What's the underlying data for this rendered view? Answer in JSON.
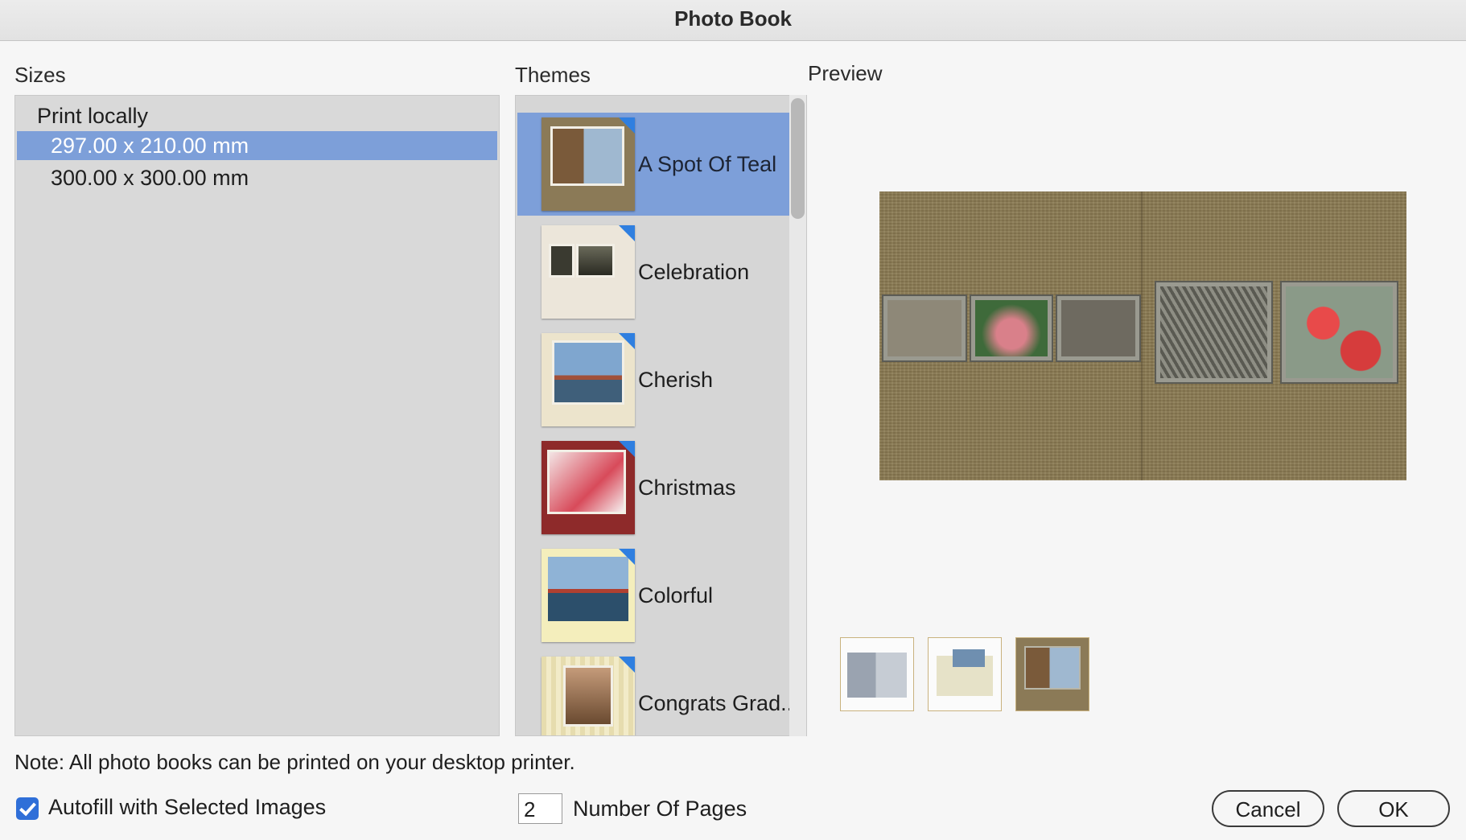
{
  "window": {
    "title": "Photo Book"
  },
  "sizes": {
    "label": "Sizes",
    "group": "Print locally",
    "items": [
      "297.00 x 210.00 mm",
      "300.00 x 300.00 mm"
    ],
    "selected_index": 0
  },
  "themes": {
    "label": "Themes",
    "items": [
      "A Spot Of Teal",
      "Celebration",
      "Cherish",
      "Christmas",
      "Colorful",
      "Congrats Grad..."
    ],
    "selected_index": 0
  },
  "preview": {
    "label": "Preview",
    "page_thumbnails": [
      "layout-thumbnail-1",
      "layout-thumbnail-2",
      "cover-thumbnail"
    ]
  },
  "note": "Note: All photo books can be printed on your desktop printer.",
  "autofill": {
    "label": "Autofill with Selected Images",
    "checked": true
  },
  "number_of_pages": {
    "value": "2",
    "label": "Number Of Pages"
  },
  "buttons": {
    "cancel": "Cancel",
    "ok": "OK"
  },
  "colors": {
    "selection": "#7d9fd9",
    "checkbox": "#2f6fd8",
    "theme_corner": "#2f7fe0"
  }
}
